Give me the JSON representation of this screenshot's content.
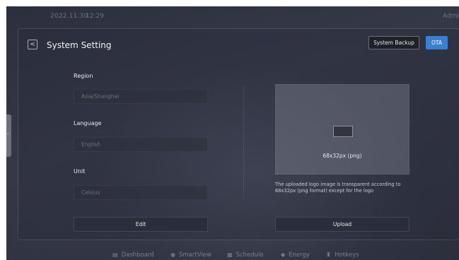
{
  "status_bar": {
    "date": "2022.11.30",
    "time": "12:29",
    "user": "Admin"
  },
  "header": {
    "back_icon": "chevron-left-icon",
    "back_glyph": "<",
    "title": "System Setting",
    "system_backup_label": "System Backup",
    "ota_label": "OTA"
  },
  "form": {
    "region": {
      "label": "Region",
      "value": "Asia/Shanghai"
    },
    "language": {
      "label": "Language",
      "value": "English"
    },
    "unit": {
      "label": "Unit",
      "value": "Celsius"
    },
    "edit_label": "Edit"
  },
  "logo": {
    "size_text": "68x32px (png)",
    "note": "The uploaded logo image is transparent according to 68x32px (png format) except for the logo",
    "upload_label": "Upload"
  },
  "side_tab": {
    "glyph": "›"
  },
  "bottom_nav": [
    {
      "label": "Dashboard",
      "icon": "dashboard-icon",
      "glyph": "▤"
    },
    {
      "label": "SmartView",
      "icon": "smartview-icon",
      "glyph": "◉"
    },
    {
      "label": "Schedule",
      "icon": "schedule-icon",
      "glyph": "▦"
    },
    {
      "label": "Energy",
      "icon": "energy-icon",
      "glyph": "◆"
    },
    {
      "label": "Hotkeys",
      "icon": "hotkeys-icon",
      "glyph": "♜"
    }
  ],
  "colors": {
    "accent": "#3a7fd1",
    "background": "#2f3240",
    "panel_border": "#4a4d5c"
  }
}
